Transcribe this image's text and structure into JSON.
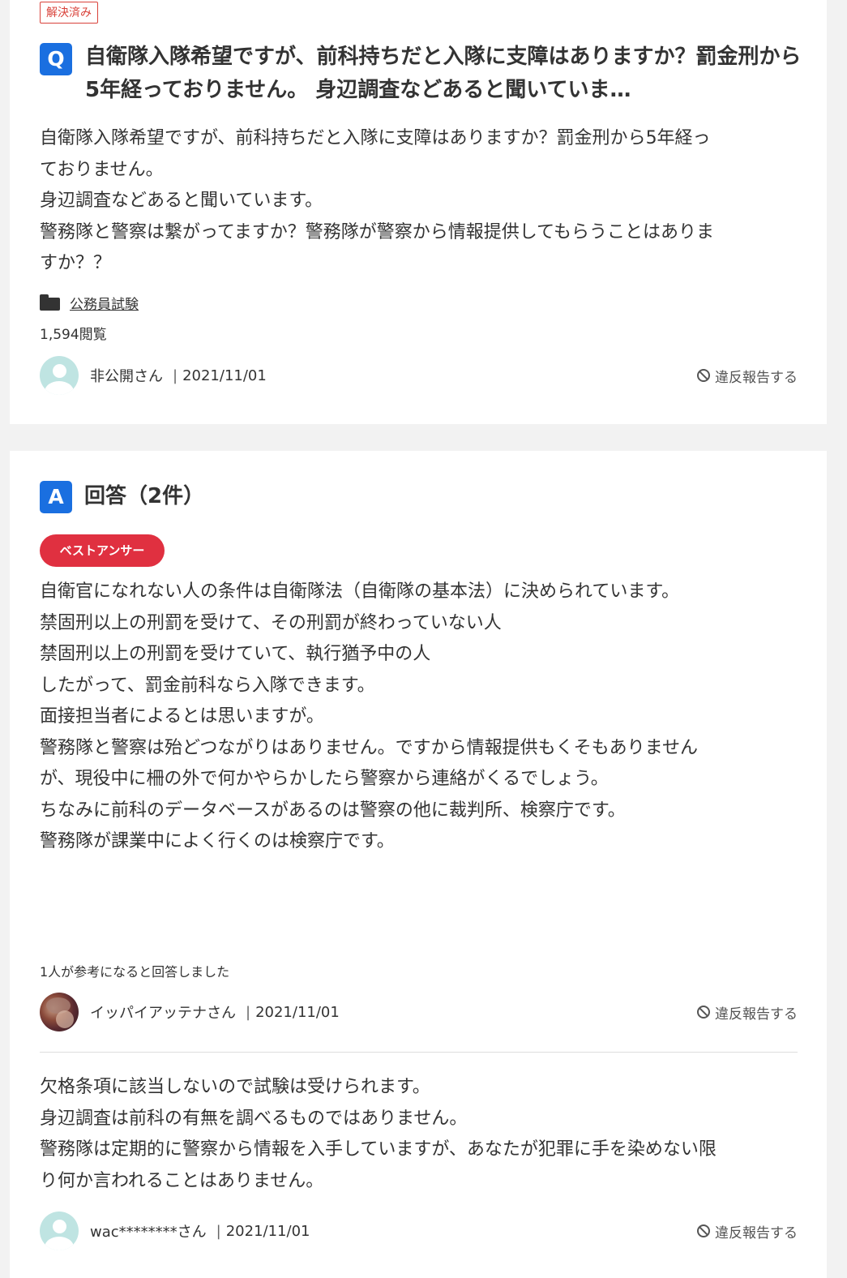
{
  "question": {
    "status_badge": "解決済み",
    "letter": "Q",
    "title": "自衛隊入隊希望ですが、前科持ちだと入隊に支障はありますか？罰金刑から5年経っておりません。 身辺調査などあると聞いていま…",
    "body_lines": [
      "自衛隊入隊希望ですが、前科持ちだと入隊に支障はありますか？罰金刑から5年経っ",
      "ておりません。",
      "身辺調査などあると聞いています。",
      "警務隊と警察は繋がってますか？警務隊が警察から情報提供してもらうことはありま",
      "すか？？"
    ],
    "category": "公務員試験",
    "views": "1,594閲覧",
    "user": {
      "name": "非公開さん",
      "separator": "|",
      "date": "2021/11/01",
      "avatar_icon": "default-user-avatar-icon"
    },
    "report_label": "違反報告する"
  },
  "answers_section": {
    "letter": "A",
    "title": "回答（2件）",
    "best_answer_badge": "ベストアンサー",
    "answers": [
      {
        "body_lines": [
          "自衛官になれない人の条件は自衛隊法（自衛隊の基本法）に決められています。",
          "",
          "禁固刑以上の刑罰を受けて、その刑罰が終わっていない人",
          "禁固刑以上の刑罰を受けていて、執行猶予中の人",
          "",
          "したがって、罰金前科なら入隊できます。",
          "面接担当者によるとは思いますが。",
          "",
          "警務隊と警察は殆どつながりはありません。ですから情報提供もくそもありません",
          "が、現役中に柵の外で何かやらかしたら警察から連絡がくるでしょう。",
          "ちなみに前科のデータベースがあるのは警察の他に裁判所、検察庁です。",
          "警務隊が課業中によく行くのは検察庁です。"
        ],
        "helpful": "1人が参考になると回答しました",
        "user": {
          "name": "イッパイアッテナさん",
          "separator": "|",
          "date": "2021/11/01"
        },
        "report_label": "違反報告する"
      },
      {
        "body_lines": [
          "欠格条項に該当しないので試験は受けられます。",
          "身辺調査は前科の有無を調べるものではありません。",
          "警務隊は定期的に警察から情報を入手していますが、あなたが犯罪に手を染めない限",
          "り何か言われることはありません。"
        ],
        "user": {
          "name": "wac********さん",
          "separator": "|",
          "date": "2021/11/01"
        },
        "report_label": "違反報告する"
      }
    ]
  },
  "colors": {
    "accent_blue": "#1a6fe0",
    "best_answer_red": "#e03040",
    "resolved_red": "#d9423a"
  }
}
